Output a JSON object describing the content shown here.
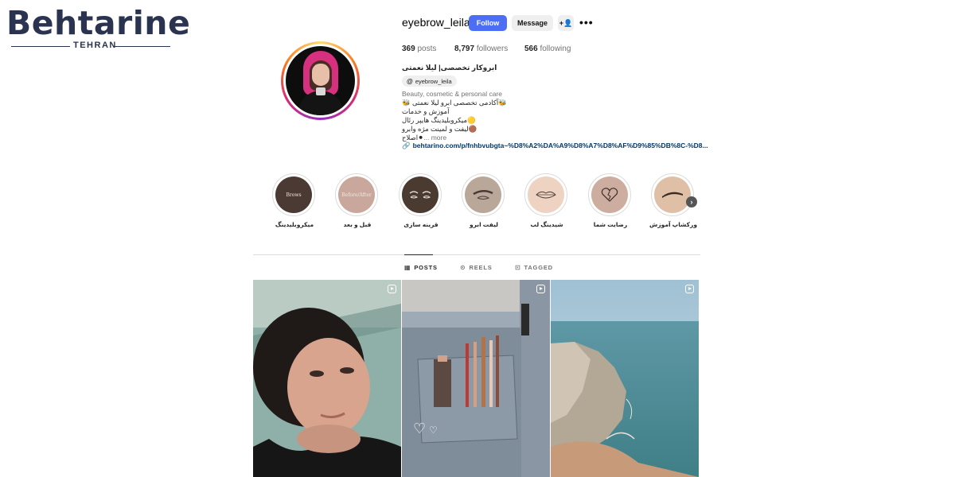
{
  "brand": {
    "name": "Behtarine",
    "subtitle": "TEHRAN"
  },
  "profile": {
    "username": "eyebrow_leila",
    "buttons": {
      "follow": "Follow",
      "message": "Message",
      "add_user_icon": "+👤",
      "more_icon": "•••"
    },
    "stats": {
      "posts": {
        "value": "369",
        "label": "posts"
      },
      "followers": {
        "value": "8,797",
        "label": "followers"
      },
      "following": {
        "value": "566",
        "label": "following"
      }
    },
    "bio": {
      "name": "ابروکار تخصصی| لیلا نعمتی",
      "threads_handle": "eyebrow_leila",
      "threads_icon": "@",
      "category": "Beauty, cosmetic & personal care",
      "lines": [
        "🐝آکادمی تخصصی ابرو لیلا نعمتی 🐝",
        "آموزش و خدمات",
        "🟡میکروبلیدینگ هایپر رئال",
        "🟤لیفت و لمینت مژه وابرو",
        "⚫اصلاح"
      ],
      "more": "... more",
      "link": "behtarino.com/p/fnhbvubgta~%D8%A2%DA%A9%D8%A7%D8%AF%D9%85%DB%8C-%D8...",
      "link_icon": "🔗"
    }
  },
  "highlights": [
    {
      "label": "میکروبلیدینگ",
      "cover_text": "Brows",
      "color": "#4a3a33"
    },
    {
      "label": "قبل و بعد",
      "cover_text": "Before/After",
      "color": "#c9a79c"
    },
    {
      "label": "قرینه سازی",
      "cover_text": "",
      "color": "#4b3a2f"
    },
    {
      "label": "لیفت ابرو",
      "cover_text": "",
      "color": "#b9a79a"
    },
    {
      "label": "شیدینگ لب",
      "cover_text": "",
      "color": "#eed3c2"
    },
    {
      "label": "رضایت شما",
      "cover_text": "",
      "color": "#ccad9f"
    },
    {
      "label": "ورکشاپ آموزش",
      "cover_text": "",
      "color": "#dfc0a6"
    }
  ],
  "highlight_next_icon": "›",
  "tabs": [
    {
      "label": "POSTS",
      "icon": "▦",
      "active": true
    },
    {
      "label": "REELS",
      "icon": "⊙",
      "active": false
    },
    {
      "label": "TAGGED",
      "icon": "⊡",
      "active": false
    }
  ],
  "posts": [
    {
      "type": "reel",
      "subject": "woman-portrait"
    },
    {
      "type": "reel",
      "subject": "pencils-in-jeans-pocket"
    },
    {
      "type": "reel",
      "subject": "coastal-cliffs"
    }
  ],
  "colors": {
    "follow_button": "#4c6ef5",
    "link": "#00376b",
    "brand": "#2a3350",
    "brand_accent": "#d8242c"
  }
}
